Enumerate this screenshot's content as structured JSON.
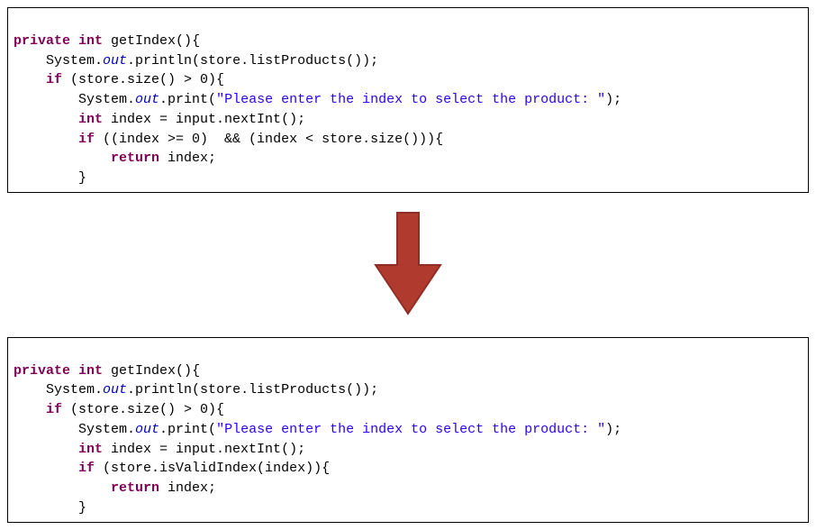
{
  "code_before": {
    "l1": {
      "kw1": "private",
      "kw2": "int",
      "rest": " getIndex(){"
    },
    "l2": {
      "pre": "    System.",
      "out": "out",
      "rest": ".println(store.listProducts());"
    },
    "l3": {
      "pre": "    ",
      "if": "if",
      "rest": " (store.size() > 0){"
    },
    "l4": {
      "pre": "        System.",
      "out": "out",
      "mid": ".print(",
      "str": "\"Please enter the index to select the product: \"",
      "end": ");"
    },
    "l5": {
      "pre": "        ",
      "int": "int",
      "rest": " index = input.nextInt();"
    },
    "l6": {
      "pre": "        ",
      "if": "if",
      "rest": " ((index >= 0)  && (index < store.size())){"
    },
    "l7": {
      "pre": "            ",
      "ret": "return",
      "rest": " index;"
    },
    "l8": {
      "rest": "        }"
    }
  },
  "code_after": {
    "l1": {
      "kw1": "private",
      "kw2": "int",
      "rest": " getIndex(){"
    },
    "l2": {
      "pre": "    System.",
      "out": "out",
      "rest": ".println(store.listProducts());"
    },
    "l3": {
      "pre": "    ",
      "if": "if",
      "rest": " (store.size() > 0){"
    },
    "l4": {
      "pre": "        System.",
      "out": "out",
      "mid": ".print(",
      "str": "\"Please enter the index to select the product: \"",
      "end": ");"
    },
    "l5": {
      "pre": "        ",
      "int": "int",
      "rest": " index = input.nextInt();"
    },
    "l6": {
      "pre": "        ",
      "if": "if",
      "rest": " (store.isValidIndex(index)){"
    },
    "l7": {
      "pre": "            ",
      "ret": "return",
      "rest": " index;"
    },
    "l8": {
      "rest": "        }"
    }
  },
  "arrow": {
    "color_fill": "#b03a2e",
    "color_stroke": "#8e2f26"
  }
}
